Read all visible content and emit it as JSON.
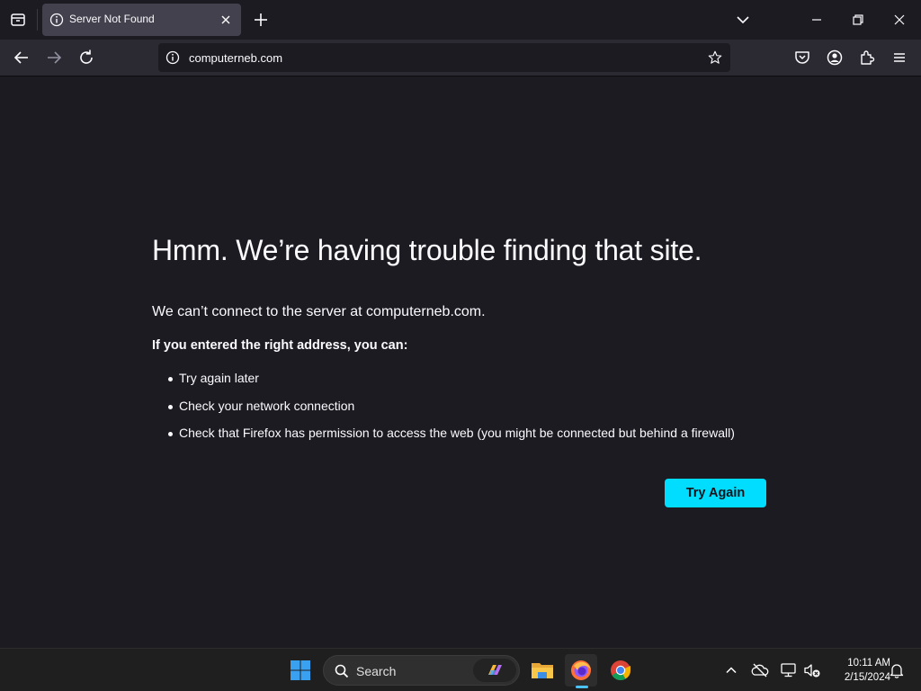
{
  "browser": {
    "tab": {
      "title": "Server Not Found"
    },
    "url": "computerneb.com"
  },
  "error_page": {
    "title": "Hmm. We’re having trouble finding that site.",
    "description": "We can’t connect to the server at computerneb.com.",
    "suggestions_heading": "If you entered the right address, you can:",
    "suggestions": [
      "Try again later",
      "Check your network connection",
      "Check that Firefox has permission to access the web (you might be connected but behind a firewall)"
    ],
    "try_again_label": "Try Again",
    "button_color": "#00ddff"
  },
  "taskbar": {
    "search_label": "Search",
    "time": "10:11 AM",
    "date": "2/15/2024",
    "accent_color": "#4cc2ff"
  },
  "icons": {
    "tab_strip": [
      "list-all-tabs-icon",
      "info-icon",
      "close-icon",
      "plus-icon",
      "chevron-down-icon",
      "minimize-icon",
      "restore-icon",
      "window-close-icon"
    ],
    "navigation": [
      "back-arrow-icon",
      "forward-arrow-icon",
      "reload-icon",
      "info-icon",
      "star-icon",
      "pocket-icon",
      "account-icon",
      "extensions-icon",
      "hamburger-menu-icon"
    ],
    "taskbar": [
      "windows-start-icon",
      "search-icon",
      "copilot-icon",
      "file-explorer-icon",
      "firefox-icon",
      "chrome-icon",
      "chevron-up-icon",
      "onedrive-offline-icon",
      "network-icon",
      "volume-muted-icon",
      "notification-bell-icon"
    ]
  }
}
